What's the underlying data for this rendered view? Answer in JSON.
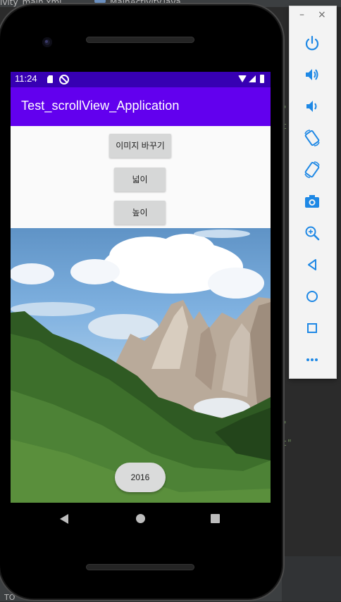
{
  "ide": {
    "tab_left": "ivity_main.xml",
    "tab_right": "MainActivity.java",
    "bottom_text": "TO"
  },
  "status_bar": {
    "time": "11:24"
  },
  "app": {
    "title": "Test_scrollView_Application",
    "buttons": {
      "change_image": "이미지 바꾸기",
      "width": "넓이",
      "height": "높이"
    },
    "year_label": "2016"
  },
  "emulator_toolbar": {
    "window_controls": [
      "–",
      "×"
    ],
    "actions": [
      {
        "icon": "power-icon"
      },
      {
        "icon": "volume-up-icon"
      },
      {
        "icon": "volume-down-icon"
      },
      {
        "icon": "rotate-left-icon"
      },
      {
        "icon": "rotate-right-icon"
      },
      {
        "icon": "camera-icon"
      },
      {
        "icon": "zoom-icon"
      },
      {
        "icon": "back-icon"
      },
      {
        "icon": "home-icon"
      },
      {
        "icon": "overview-icon"
      },
      {
        "icon": "more-icon"
      }
    ]
  },
  "colors": {
    "status_bar": "#3700b3",
    "app_bar": "#6200ee",
    "toolbar_icon": "#1e88e5"
  }
}
